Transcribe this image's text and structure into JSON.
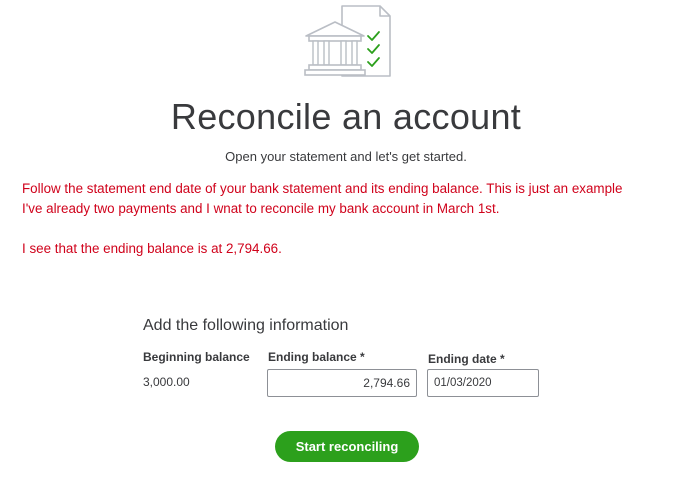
{
  "header": {
    "icon": "bank-document-checklist-icon",
    "title": "Reconcile an account",
    "subtitle": "Open your statement and let's get started."
  },
  "annotation": {
    "color": "#d0021b",
    "line1": "Follow the statement end date of your bank statement and its ending balance. This is just an example",
    "line2": "I've already two payments and I wnat to reconcile my bank account in March 1st.",
    "line3": "I see that the ending balance is at 2,794.66."
  },
  "form": {
    "heading": "Add the following information",
    "beginning_balance_label": "Beginning balance",
    "beginning_balance_value": "3,000.00",
    "ending_balance_label": "Ending balance *",
    "ending_balance_value": "2,794.66",
    "ending_date_label": "Ending date *",
    "ending_date_value": "01/03/2020"
  },
  "actions": {
    "start_label": "Start reconciling",
    "start_color": "#2ca01c"
  }
}
